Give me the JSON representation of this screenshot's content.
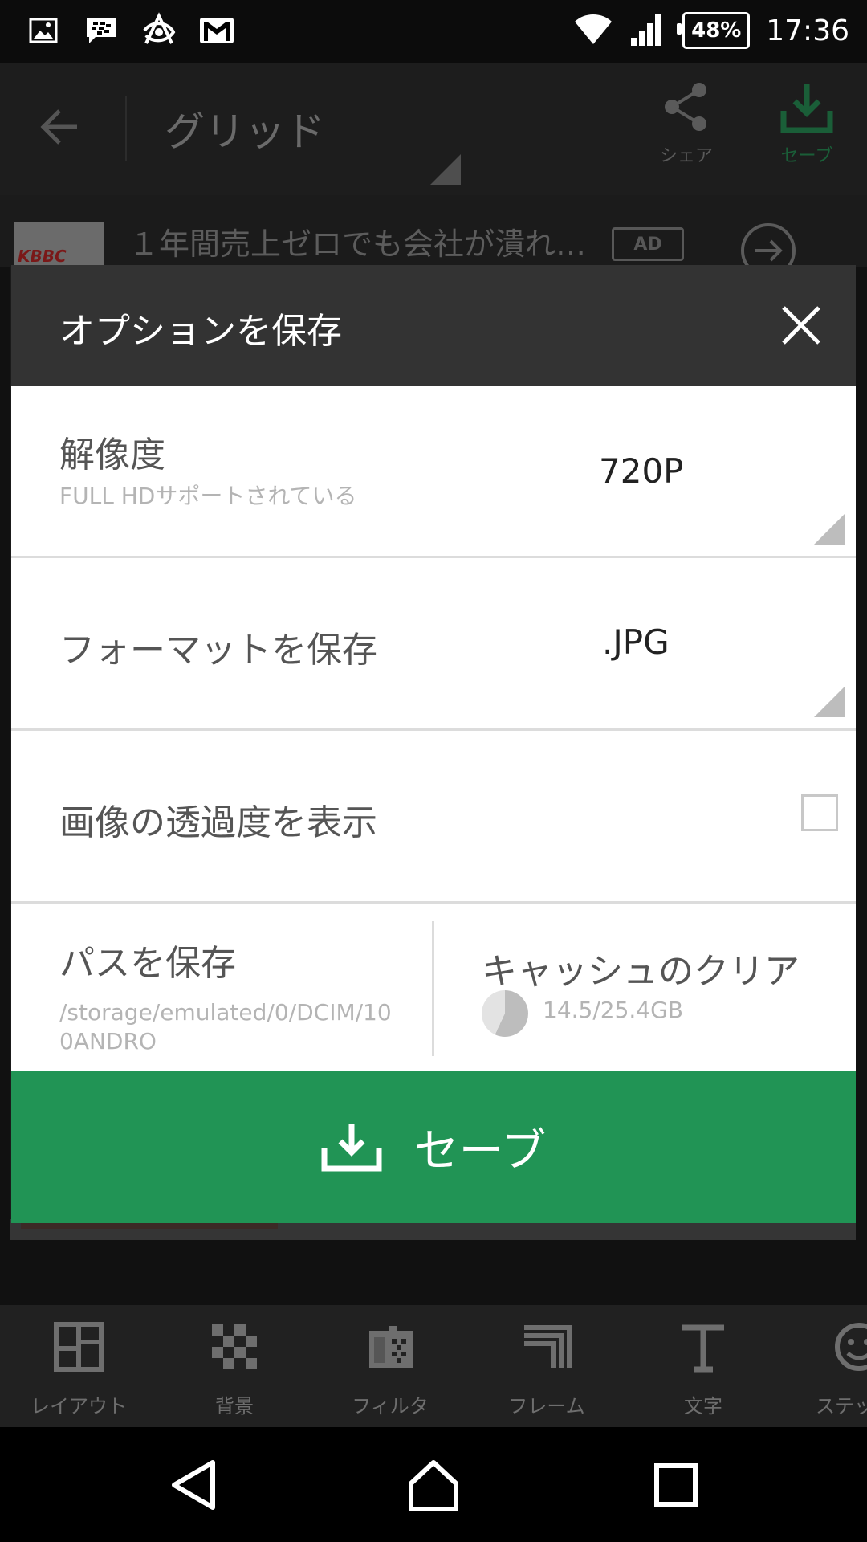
{
  "status_bar": {
    "notification_icons": [
      "image-icon",
      "blackberry-messenger-icon",
      "app-icon",
      "gmail-icon"
    ],
    "battery": "48%",
    "time": "17:36"
  },
  "app_bar": {
    "title": "グリッド",
    "share_label": "シェア",
    "save_label": "セーブ"
  },
  "ad": {
    "thumb_text": "KBBC",
    "text": "１年間売上ゼロでも会社が潰れ…",
    "badge": "AD"
  },
  "dialog": {
    "title": "オプションを保存",
    "resolution": {
      "label": "解像度",
      "sublabel": "FULL HDサポートされている",
      "value": "720P"
    },
    "format": {
      "label": "フォーマットを保存",
      "value": ".JPG"
    },
    "transparency": {
      "label": "画像の透過度を表示",
      "checked": false
    },
    "save_path": {
      "label": "パスを保存",
      "path": "/storage/emulated/0/DCIM/100ANDRO"
    },
    "cache": {
      "label": "キャッシュのクリア",
      "usage": "14.5/25.4GB"
    },
    "save_button": "セーブ"
  },
  "toolbar": {
    "items": [
      {
        "label": "レイアウト",
        "icon": "layout-icon"
      },
      {
        "label": "背景",
        "icon": "checkerboard-icon"
      },
      {
        "label": "フィルタ",
        "icon": "filter-icon"
      },
      {
        "label": "フレーム",
        "icon": "frame-icon"
      },
      {
        "label": "文字",
        "icon": "text-icon"
      },
      {
        "label": "ステッ",
        "icon": "sticker-icon"
      }
    ]
  },
  "colors": {
    "accent_green": "#219455",
    "dialog_header": "#333333"
  }
}
